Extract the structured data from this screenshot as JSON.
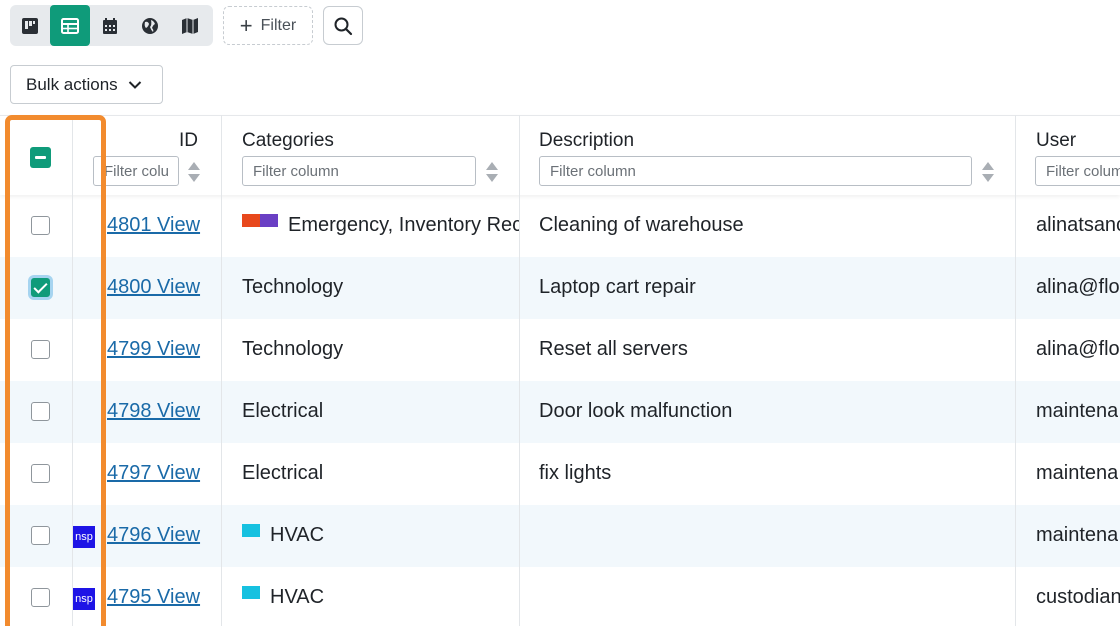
{
  "toolbar": {
    "views": [
      {
        "icon": "board-icon"
      },
      {
        "icon": "table-icon",
        "active": true
      },
      {
        "icon": "calendar-icon"
      },
      {
        "icon": "globe-icon"
      },
      {
        "icon": "map-icon"
      }
    ],
    "filter_label": "Filter",
    "search_icon": "search-icon",
    "bulk_label": "Bulk actions"
  },
  "table": {
    "columns": {
      "id": {
        "title": "ID",
        "placeholder": "Filter column"
      },
      "categories": {
        "title": "Categories",
        "placeholder": "Filter column"
      },
      "description": {
        "title": "Description",
        "placeholder": "Filter column"
      },
      "user": {
        "title": "User",
        "placeholder": "Filter column"
      }
    },
    "rows": [
      {
        "id": "4801 View",
        "categories": "Emergency, Inventory Rec",
        "description": "Cleaning of warehouse",
        "user": "alinatsanc",
        "checked": false
      },
      {
        "id": "4800 View",
        "categories": "Technology",
        "description": "Laptop cart repair",
        "user": "alina@flo",
        "checked": true
      },
      {
        "id": "4799 View",
        "categories": "Technology",
        "description": "Reset all servers",
        "user": "alina@flo",
        "checked": false
      },
      {
        "id": "4798 View",
        "categories": "Electrical",
        "description": "Door look malfunction",
        "user": "maintena",
        "checked": false
      },
      {
        "id": "4797 View",
        "categories": "Electrical",
        "description": "fix lights",
        "user": "maintena",
        "checked": false
      },
      {
        "id": "4796 View",
        "categories": "HVAC",
        "description": "",
        "user": "maintena",
        "badge": "nsp",
        "checked": false
      },
      {
        "id": "4795 View",
        "categories": "HVAC",
        "description": "",
        "user": "custodian",
        "badge": "nsp",
        "checked": false
      }
    ]
  },
  "colors": {
    "accent": "#0f9b7a",
    "link": "#1a6aa8",
    "highlight": "#f28b2e",
    "swatch_emergency": "#e8481c",
    "swatch_inventory": "#6a3fc4",
    "swatch_hvac": "#16c1e0",
    "badge": "#1e14e6"
  }
}
